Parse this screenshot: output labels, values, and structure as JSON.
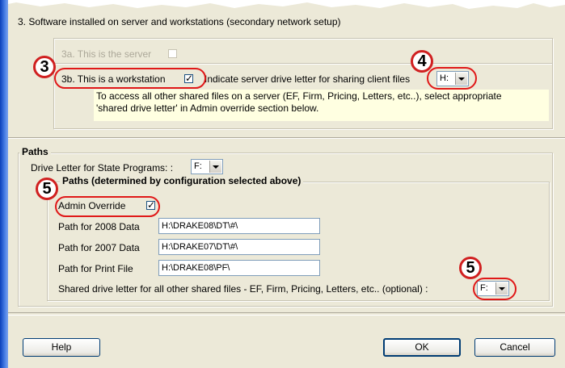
{
  "section3": {
    "title": "3.  Software installed on server and workstations (secondary network setup)",
    "server_label": "3a.  This is the server",
    "server_checked": false,
    "workstation_label": "3b.  This is a workstation",
    "workstation_checked": true,
    "drive_label": "Indicate server drive letter for sharing client files",
    "drive_value": "H:",
    "note": "To access all other shared files on a server (EF, Firm, Pricing, Letters, etc..), select appropriate 'shared drive letter' in Admin override section below."
  },
  "paths": {
    "title": "Paths",
    "state_programs_label": "Drive Letter for State Programs: :",
    "state_programs_value": "F:",
    "sub_title": "Paths (determined by configuration selected above)",
    "admin_override_label": "Admin Override",
    "admin_override_checked": true,
    "path_2008_label": "Path for 2008 Data",
    "path_2008_value": "H:\\DRAKE08\\DT\\#\\",
    "path_2007_label": "Path for 2007 Data",
    "path_2007_value": "H:\\DRAKE07\\DT\\#\\",
    "print_file_label": "Path  for  Print File",
    "print_file_value": "H:\\DRAKE08\\PF\\",
    "shared_drive_label": "Shared drive letter for all other shared files - EF, Firm, Pricing, Letters, etc.. (optional) :",
    "shared_drive_value": "F:"
  },
  "callouts": {
    "badge_3": "3",
    "badge_4": "4",
    "badge_5a": "5",
    "badge_5b": "5"
  },
  "buttons": {
    "help": "Help",
    "ok": "OK",
    "cancel": "Cancel"
  },
  "colors": {
    "dialog_bg": "#ece9d8",
    "note_bg": "#ffffe1",
    "callout_red": "#e01818"
  }
}
